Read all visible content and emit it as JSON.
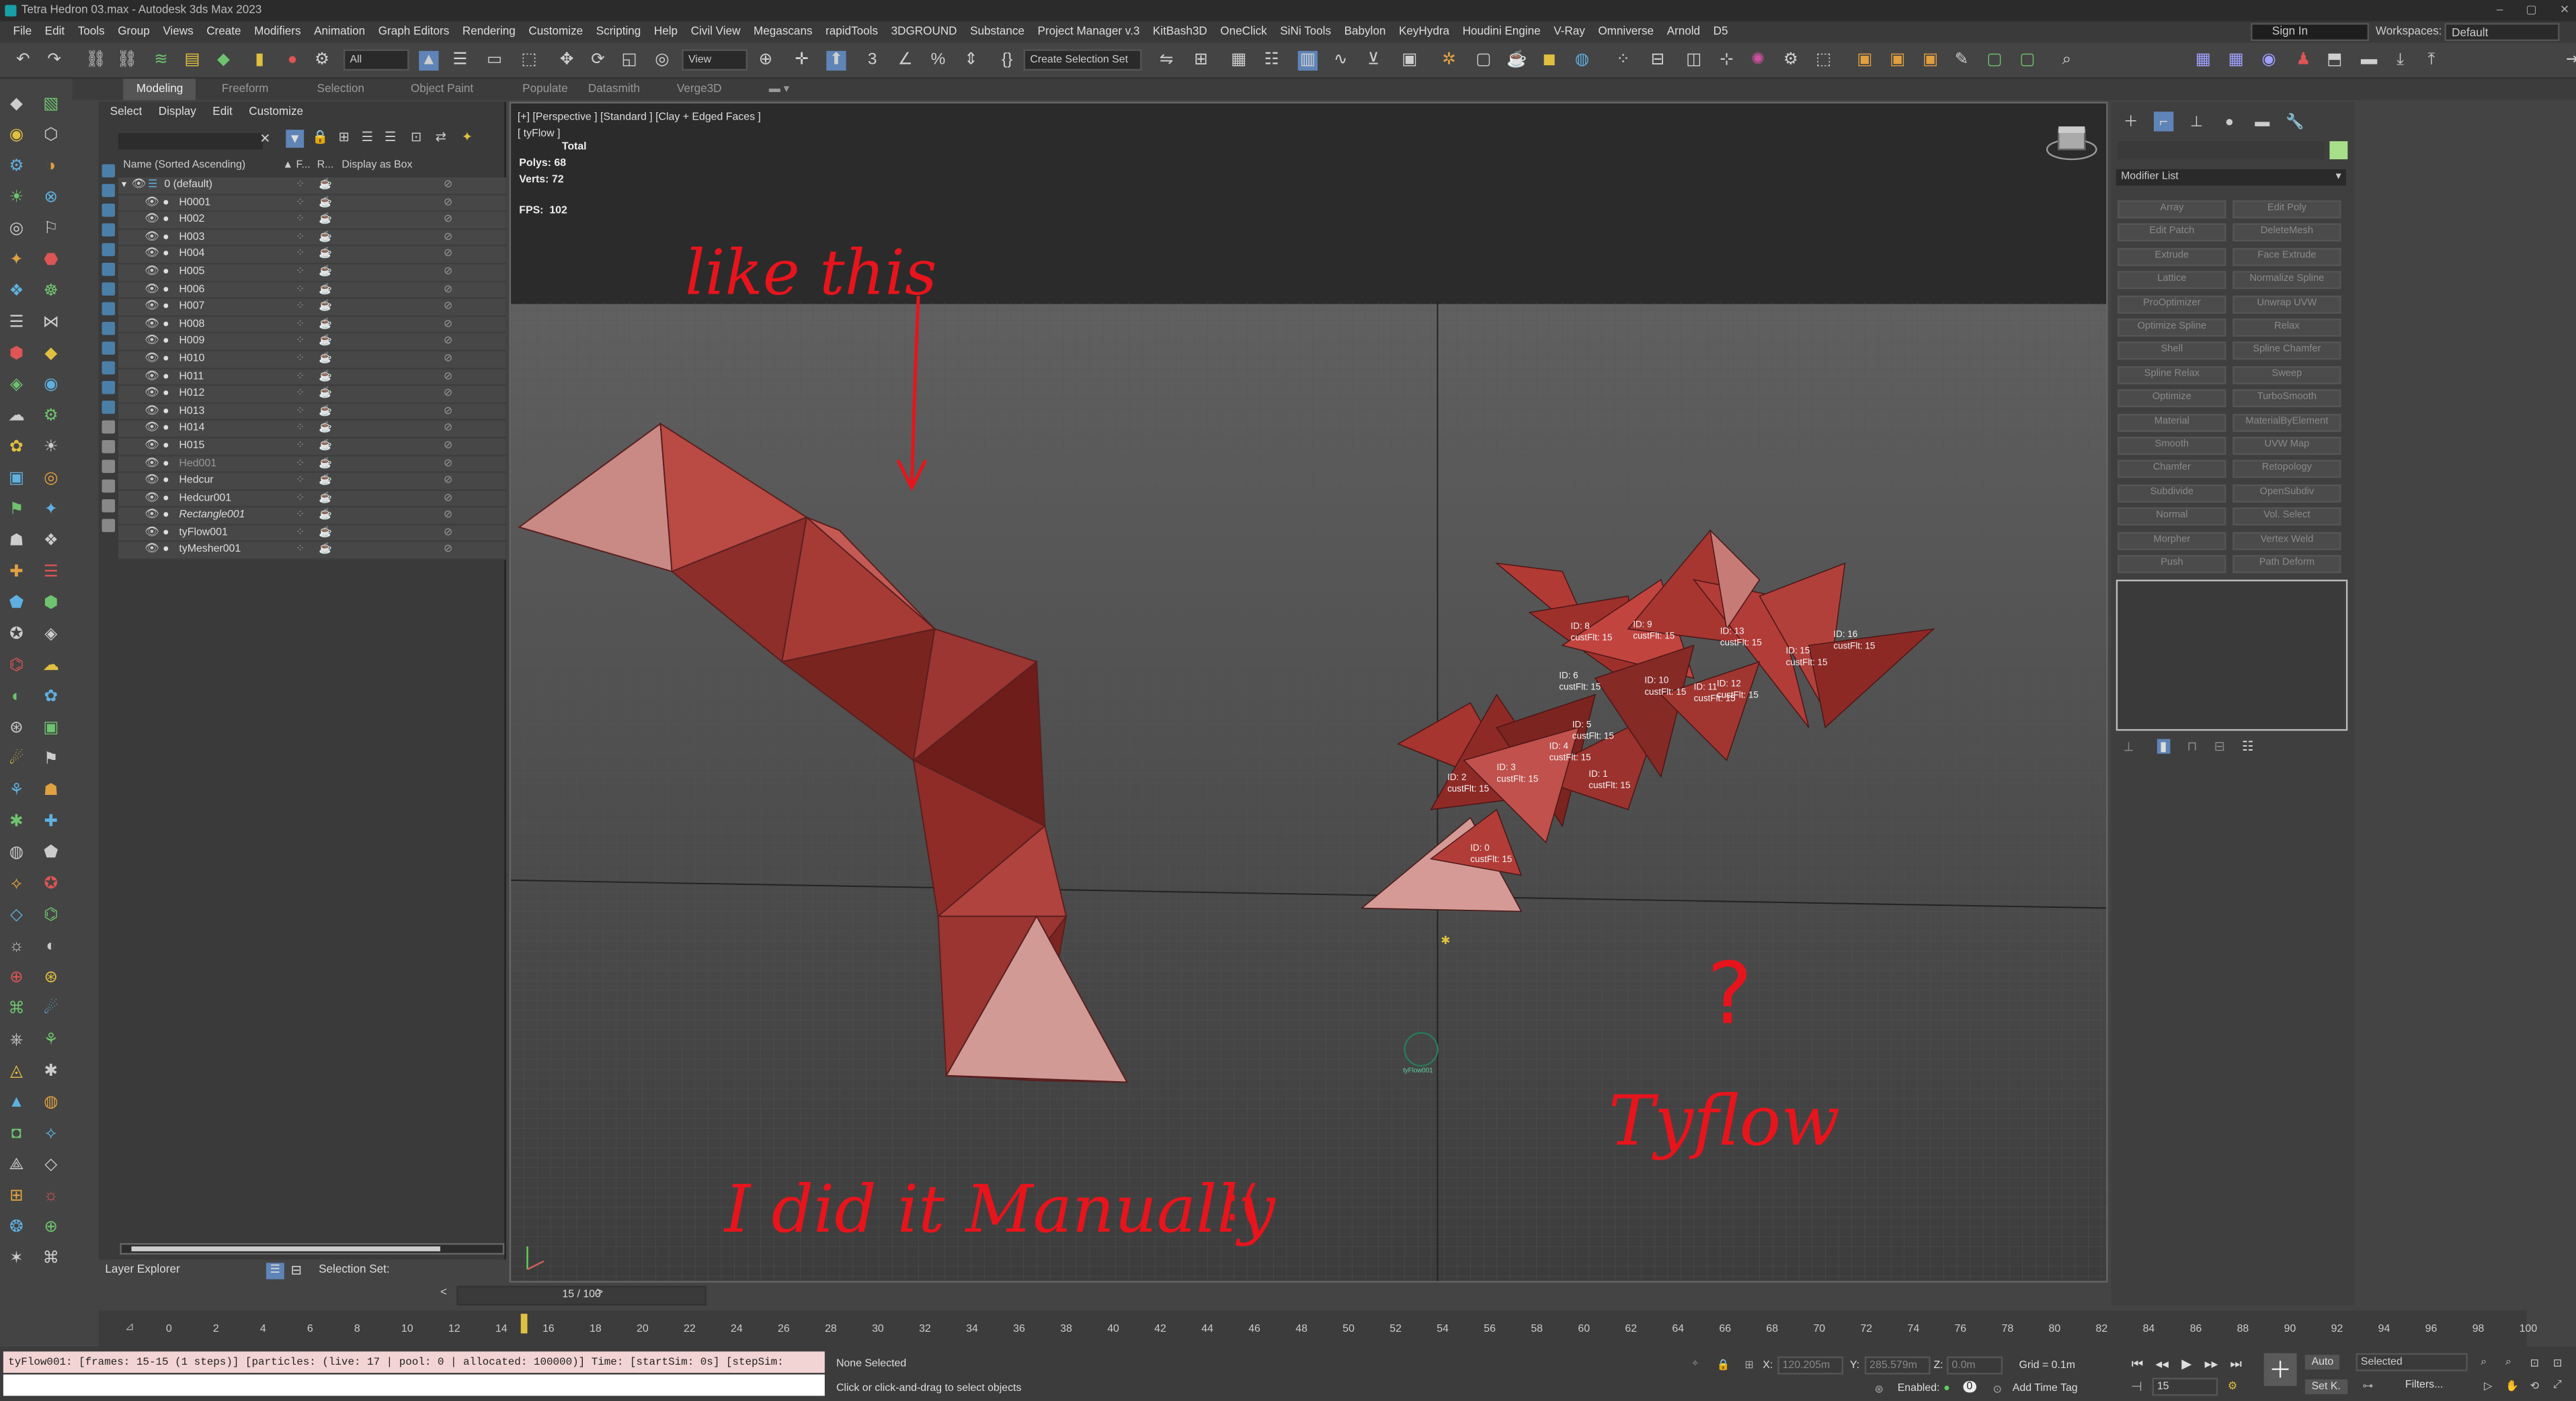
{
  "title": "Tetra Hedron 03.max - Autodesk 3ds Max 2023",
  "window_controls": {
    "min": "–",
    "max": "▢",
    "close": "✕"
  },
  "menu": [
    "File",
    "Edit",
    "Tools",
    "Group",
    "Views",
    "Create",
    "Modifiers",
    "Animation",
    "Graph Editors",
    "Rendering",
    "Customize",
    "Scripting",
    "Help",
    "Civil View",
    "Megascans",
    "rapidTools",
    "3DGROUND",
    "Substance",
    "Project Manager v.3",
    "KitBash3D",
    "OneClick",
    "SiNi Tools",
    "Babylon",
    "KeyHydra",
    "Houdini Engine",
    "V-Ray",
    "Omniverse",
    "Arnold",
    "D5"
  ],
  "sign_in": "Sign In",
  "workspaces": {
    "label": "Workspaces:",
    "value": "Default"
  },
  "toolbar": {
    "filter_all": "All",
    "view": "View",
    "selection_set": "Create Selection Set"
  },
  "ribbon_tabs": [
    "Modeling",
    "Freeform",
    "Selection",
    "Object Paint",
    "Populate",
    "Datasmith",
    "Verge3D"
  ],
  "scene_explorer": {
    "menu": [
      "Select",
      "Display",
      "Edit",
      "Customize"
    ],
    "columns": {
      "name": "Name (Sorted Ascending)",
      "frozen": "▲ F...",
      "renderable": "R...",
      "display_as_box": "Display as Box"
    },
    "rows": [
      {
        "name": "0 (default)",
        "type": "layer"
      },
      {
        "name": "H0001"
      },
      {
        "name": "H002"
      },
      {
        "name": "H003"
      },
      {
        "name": "H004"
      },
      {
        "name": "H005"
      },
      {
        "name": "H006"
      },
      {
        "name": "H007"
      },
      {
        "name": "H008"
      },
      {
        "name": "H009"
      },
      {
        "name": "H010"
      },
      {
        "name": "H011"
      },
      {
        "name": "H012"
      },
      {
        "name": "H013"
      },
      {
        "name": "H014"
      },
      {
        "name": "H015"
      },
      {
        "name": "Hed001",
        "dim": true
      },
      {
        "name": "Hedcur"
      },
      {
        "name": "Hedcur001"
      },
      {
        "name": "Rectangle001",
        "italic": true
      },
      {
        "name": "tyFlow001"
      },
      {
        "name": "tyMesher001"
      }
    ],
    "layer_explorer": "Layer Explorer",
    "selection_set": "Selection Set:"
  },
  "viewport": {
    "label": "[+] [Perspective ] [Standard ] [Clay + Edged Faces ]",
    "sublabel": "[ tyFlow ]",
    "stats": {
      "total_label": "Total",
      "polys_label": "Polys:",
      "polys": "68",
      "verts_label": "Verts:",
      "verts": "72",
      "fps_label": "FPS:",
      "fps": "102"
    },
    "annotations": {
      "top": "like this",
      "bottom": "I did it Manually",
      "sad": ":(",
      "question": "?",
      "tyflow": "Tyflow"
    },
    "particle_labels": [
      {
        "id": "ID: 0",
        "sub": "custFlt: 15"
      },
      {
        "id": "ID: 1",
        "sub": "custFlt: 15"
      },
      {
        "id": "ID: 2",
        "sub": "custFlt: 15"
      },
      {
        "id": "ID: 3",
        "sub": "custFlt: 15"
      },
      {
        "id": "ID: 4",
        "sub": "custFlt: 15"
      },
      {
        "id": "ID: 5",
        "sub": "custFlt: 15"
      },
      {
        "id": "ID: 6",
        "sub": "custFlt: 15"
      },
      {
        "id": "ID: 8",
        "sub": "custFlt: 15"
      },
      {
        "id": "ID: 9",
        "sub": "custFlt: 15"
      },
      {
        "id": "ID: 10",
        "sub": "custFlt: 15"
      },
      {
        "id": "ID: 11",
        "sub": "custFlt: 15"
      },
      {
        "id": "ID: 12",
        "sub": "custFlt: 15"
      },
      {
        "id": "ID: 13",
        "sub": "custFlt: 15"
      },
      {
        "id": "ID: 15",
        "sub": "custFlt: 15"
      },
      {
        "id": "ID: 16",
        "sub": "custFlt: 15"
      }
    ],
    "origin_label": "tyFlow001"
  },
  "command_panel": {
    "modifier_list": "Modifier List",
    "buttons": [
      "Array",
      "Edit Poly",
      "Edit Patch",
      "DeleteMesh",
      "Extrude",
      "Face Extrude",
      "Lattice",
      "Normalize Spline",
      "ProOptimizer",
      "Unwrap UVW",
      "Optimize Spline",
      "Relax",
      "Shell",
      "Spline Chamfer",
      "Spline Relax",
      "Sweep",
      "Optimize",
      "TurboSmooth",
      "Material",
      "MaterialByElement",
      "Smooth",
      "UVW Map",
      "Chamfer",
      "Retopology",
      "Subdivide",
      "OpenSubdiv",
      "Normal",
      "Vol. Select",
      "Morpher",
      "Vertex Weld",
      "Push",
      "Path Deform"
    ]
  },
  "timeline": {
    "slider": "15 / 100",
    "ticks": [
      "0",
      "2",
      "4",
      "6",
      "8",
      "10",
      "12",
      "14",
      "16",
      "18",
      "20",
      "22",
      "24",
      "26",
      "28",
      "30",
      "32",
      "34",
      "36",
      "38",
      "40",
      "42",
      "44",
      "46",
      "48",
      "50",
      "52",
      "54",
      "56",
      "58",
      "60",
      "62",
      "64",
      "66",
      "68",
      "70",
      "72",
      "74",
      "76",
      "78",
      "80",
      "82",
      "84",
      "86",
      "88",
      "90",
      "92",
      "94",
      "96",
      "98",
      "100"
    ]
  },
  "status": {
    "maxscript": "tyFlow001: [frames: 15-15 (1 steps)] [particles: (live: 17 | pool: 0 | allocated: 100000)] Time: [startSim: 0s] [stepSim:",
    "selection": "None Selected",
    "prompt": "Click or click-and-drag to select objects",
    "x_label": "X:",
    "x": "120.205m",
    "y_label": "Y:",
    "y": "285.579m",
    "z_label": "Z:",
    "z": "0.0m",
    "grid": "Grid = 0.1m",
    "enabled": "Enabled:",
    "add_time_tag": "Add Time Tag",
    "auto": "Auto",
    "set_key": "Set K.",
    "selected": "Selected",
    "filters": "Filters...",
    "frame": "15"
  }
}
